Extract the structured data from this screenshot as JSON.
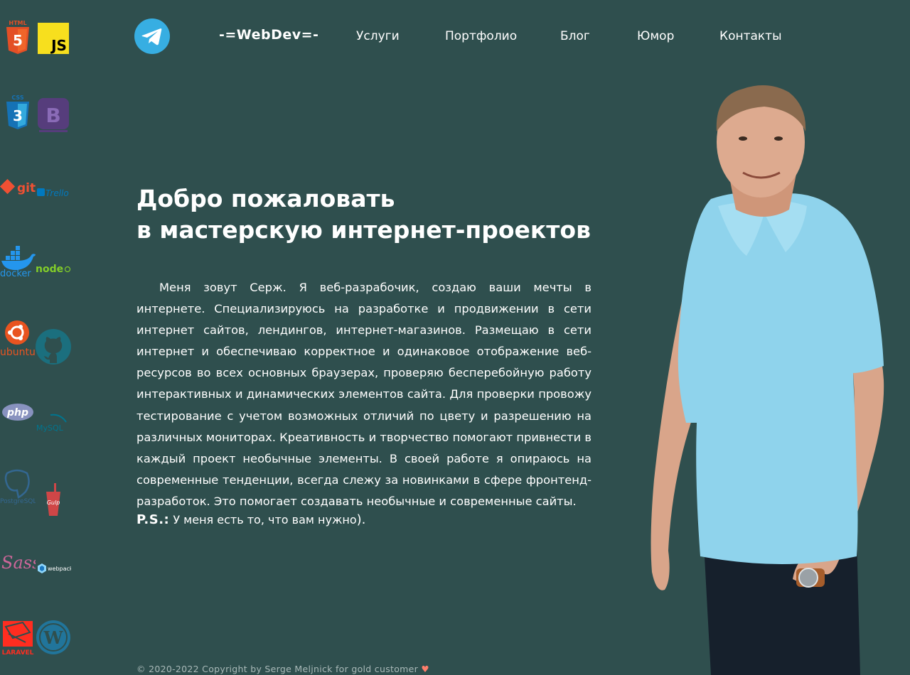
{
  "header": {
    "telegram_icon": "telegram-icon",
    "logo": "-=WebDev=-",
    "nav": [
      {
        "label": "Услуги"
      },
      {
        "label": "Портфолио"
      },
      {
        "label": "Блог"
      },
      {
        "label": "Юмор"
      },
      {
        "label": "Контакты"
      }
    ]
  },
  "sidebar": {
    "tech_icons": [
      {
        "name": "html5-icon",
        "label": "HTML"
      },
      {
        "name": "javascript-icon",
        "label": "JS"
      },
      {
        "name": "css3-icon",
        "label": "CSS"
      },
      {
        "name": "bootstrap-icon",
        "label": "B"
      },
      {
        "name": "git-icon",
        "label": "git"
      },
      {
        "name": "trello-icon",
        "label": "Trello"
      },
      {
        "name": "docker-icon",
        "label": "docker"
      },
      {
        "name": "nodejs-icon",
        "label": "node"
      },
      {
        "name": "ubuntu-icon",
        "label": "ubuntu"
      },
      {
        "name": "github-icon",
        "label": ""
      },
      {
        "name": "php-icon",
        "label": "php"
      },
      {
        "name": "mysql-icon",
        "label": "MySQL"
      },
      {
        "name": "postgresql-icon",
        "label": "PostgreSQL"
      },
      {
        "name": "gulp-icon",
        "label": "Gulp"
      },
      {
        "name": "sass-icon",
        "label": "Sass"
      },
      {
        "name": "webpack-icon",
        "label": "webpack"
      },
      {
        "name": "laravel-icon",
        "label": "LARAVEL"
      },
      {
        "name": "wordpress-icon",
        "label": "W"
      }
    ]
  },
  "hero": {
    "title_line1": "Добро пожаловать",
    "title_line2": "в мастерскую интернет-проектов",
    "about": "Меня зовут Серж. Я веб-разрабочик, создаю ваши мечты в интернете. Специализируюсь на разработке и продвижении в сети интернет сайтов, лендингов, интернет-магазинов. Размещаю в сети интернет и обеспечиваю корректное и одинаковое отображение веб-ресурсов во всех основных браузерах, проверяю бесперебойную работу интерактивных и динамических элементов сайта. Для проверки провожу тестирование с учетом возможных отличий по цвету и разрешению на различных мониторах. Креативность и творчество помогают привнести в каждый проект необычные элементы. В своей работе я опираюсь на современные тенденции, всегда слежу за новинками в сфере фронтенд-разработок. Это помогает создавать необычные и современные сайты.",
    "ps_label": "P.S.:",
    "ps_text": " У меня есть то, что вам нужно",
    "ps_smile": ")."
  },
  "footer": {
    "copyright": "© 2020-2022 Copyright by Serge Meljnick for gold customer",
    "heart": "♥"
  },
  "colors": {
    "background": "#2f4f4e",
    "telegram": "#37aee2",
    "heart": "#ff7e6b"
  }
}
